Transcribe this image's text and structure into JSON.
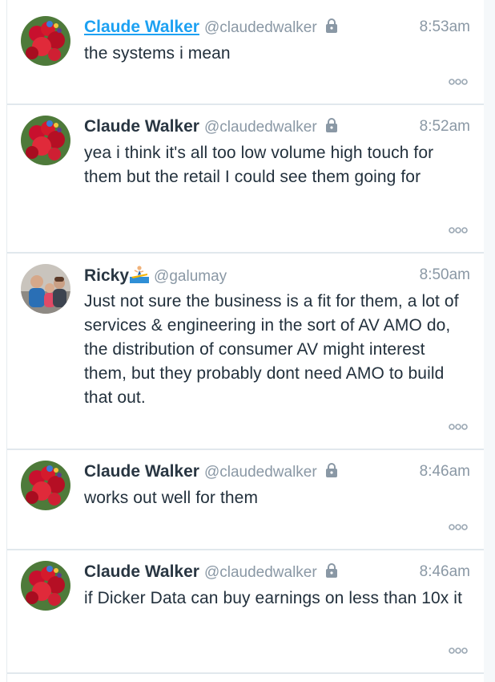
{
  "tweets": [
    {
      "name": "Claude Walker",
      "handle": "@claudedwalker",
      "locked": true,
      "time": "8:53am",
      "text": "the systems i mean",
      "avatar": "flower-avatar"
    },
    {
      "name": "Claude Walker",
      "handle": "@claudedwalker",
      "locked": true,
      "time": "8:52am",
      "text": "yea i think it's all too low volume high touch for them but the retail I could see them going for",
      "avatar": "flower-avatar"
    },
    {
      "name": "Ricky",
      "name_emoji": "surfer",
      "handle": "@galumay",
      "locked": false,
      "time": "8:50am",
      "text": "Just not sure the business is a fit for them, a lot of services & engineering in the sort of AV AMO do, the distribution of consumer AV might interest them, but they probably dont need AMO to build that out.",
      "avatar": "family-photo-avatar"
    },
    {
      "name": "Claude Walker",
      "handle": "@claudedwalker",
      "locked": true,
      "time": "8:46am",
      "text": "works out well for them",
      "avatar": "flower-avatar"
    },
    {
      "name": "Claude Walker",
      "handle": "@claudedwalker",
      "locked": true,
      "time": "8:46am",
      "text": "if Dicker Data can buy earnings on less than 10x it",
      "avatar": "flower-avatar"
    }
  ],
  "colors": {
    "link": "#1da1f2",
    "name": "#293642",
    "meta": "#8a98a5",
    "divider": "#e1e8ed"
  }
}
